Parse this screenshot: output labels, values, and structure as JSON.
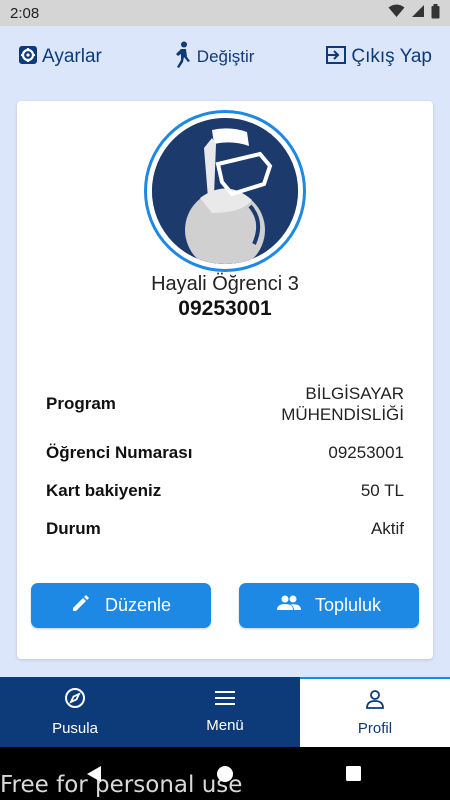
{
  "status_bar": {
    "time": "2:08"
  },
  "top_actions": {
    "settings": {
      "label": "Ayarlar",
      "icon": "gear-icon"
    },
    "switch": {
      "label": "Değiştir",
      "icon": "walking-person-icon"
    },
    "logout": {
      "label": "Çıkış Yap",
      "icon": "logout-icon"
    }
  },
  "profile": {
    "name": "Hayali Öğrenci 3",
    "student_number": "09253001",
    "info": [
      {
        "key": "Program",
        "value_line1": "BİLGİSAYAR",
        "value_line2": "MÜHENDİSLİĞİ"
      },
      {
        "key": "Öğrenci Numarası",
        "value": "09253001"
      },
      {
        "key": "Kart bakiyeniz",
        "value": "50 TL"
      },
      {
        "key": "Durum",
        "value": "Aktif"
      }
    ]
  },
  "buttons": {
    "edit": "Düzenle",
    "community": "Topluluk"
  },
  "bottom_nav": [
    {
      "label": "Pusula",
      "icon": "compass-icon"
    },
    {
      "label": "Menü",
      "icon": "menu-icon"
    },
    {
      "label": "Profil",
      "icon": "person-icon",
      "active": true
    }
  ],
  "watermark": "Free for personal use",
  "colors": {
    "primary": "#0d3b7a",
    "accent": "#1e88e5",
    "background": "#dbe6fb"
  }
}
